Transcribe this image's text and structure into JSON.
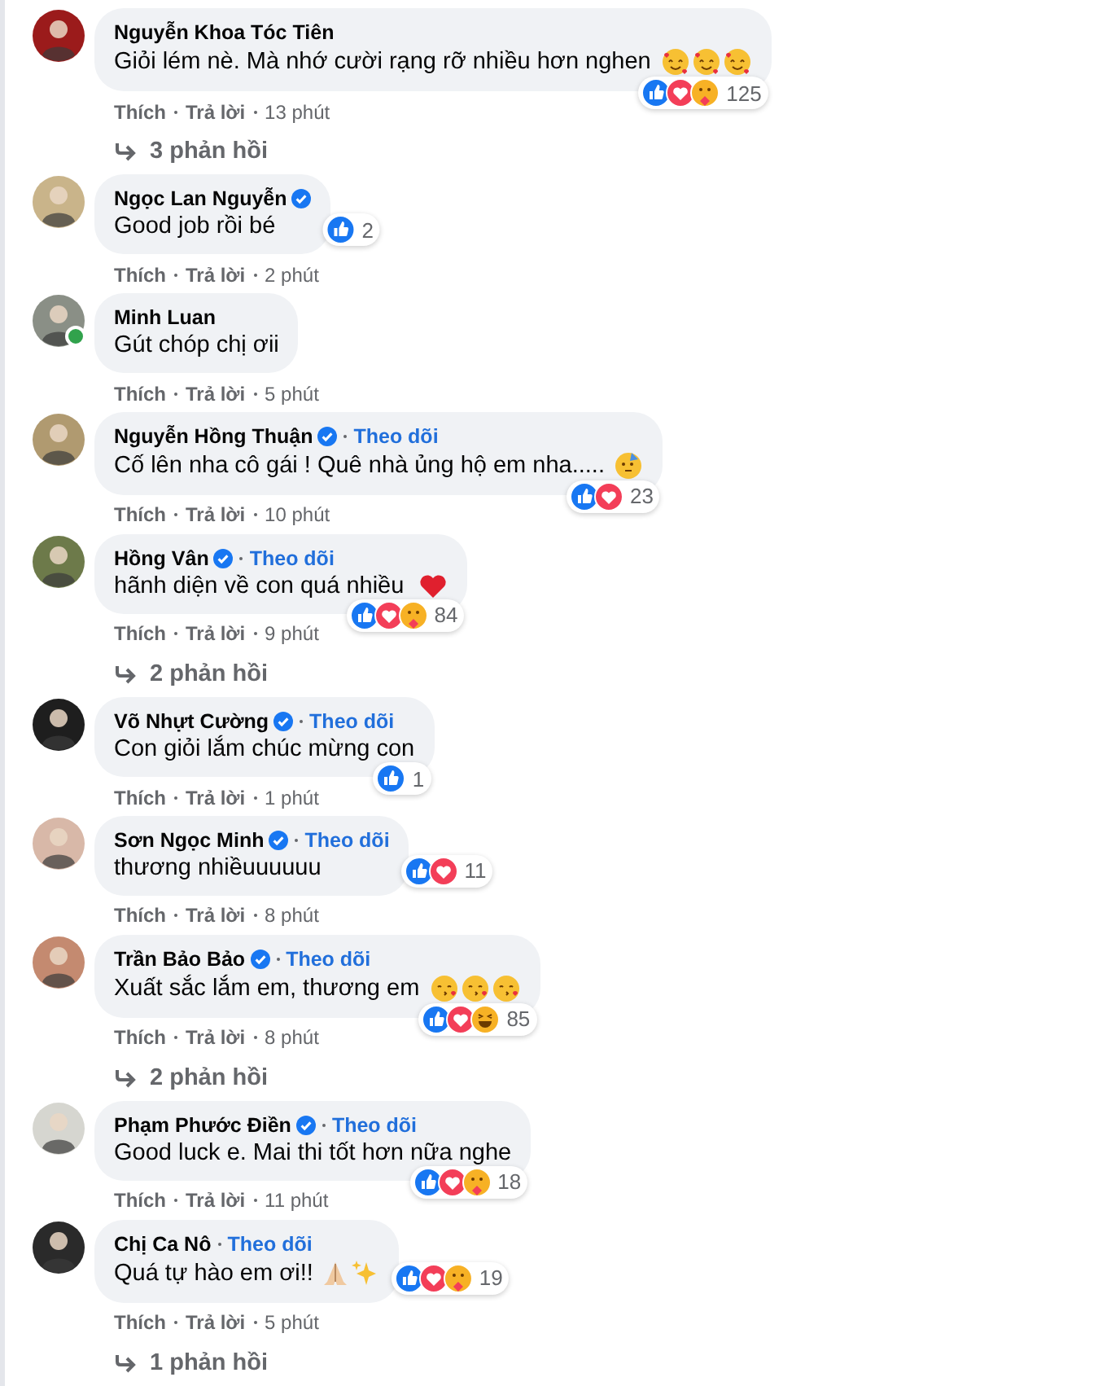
{
  "comments": [
    {
      "name": "Nguyễn Khoa Tóc Tiên",
      "verified": false,
      "online": false,
      "text": "Giỏi lém nè. Mà nhớ cười rạng rỡ nhiều hơn nghen",
      "emojis": [
        {
          "kind": "hearts-face"
        },
        {
          "kind": "hearts-face"
        },
        {
          "kind": "hearts-face"
        }
      ],
      "reactions": [
        {
          "kind": "like"
        },
        {
          "kind": "love"
        },
        {
          "kind": "care"
        }
      ],
      "reaction_count": "125",
      "like": "Thích",
      "reply": "Trả lời",
      "time": "13 phút",
      "replies": "3 phản hồi"
    },
    {
      "name": "Ngọc Lan Nguyễn",
      "verified": true,
      "online": false,
      "text": "Good job rồi bé",
      "reactions": [
        {
          "kind": "like"
        }
      ],
      "reaction_count": "2",
      "like": "Thích",
      "reply": "Trả lời",
      "time": "2 phút"
    },
    {
      "name": "Minh Luan",
      "verified": false,
      "online": true,
      "text": "Gút chóp chị ơii",
      "like": "Thích",
      "reply": "Trả lời",
      "time": "5 phút"
    },
    {
      "name": "Nguyễn Hồng Thuận",
      "verified": true,
      "online": false,
      "follow": "Theo dõi",
      "text": "Cố lên nha cô gái ! Quê nhà ủng hộ em nha.....",
      "emojis": [
        {
          "kind": "party-face"
        }
      ],
      "reactions": [
        {
          "kind": "like"
        },
        {
          "kind": "love"
        }
      ],
      "reaction_count": "23",
      "like": "Thích",
      "reply": "Trả lời",
      "time": "10 phút"
    },
    {
      "name": "Hồng Vân",
      "verified": true,
      "online": false,
      "follow": "Theo dõi",
      "text": "hãnh diện về con quá nhiều",
      "emojis": [
        {
          "kind": "heart"
        }
      ],
      "reactions": [
        {
          "kind": "like"
        },
        {
          "kind": "love"
        },
        {
          "kind": "care"
        }
      ],
      "reaction_count": "84",
      "like": "Thích",
      "reply": "Trả lời",
      "time": "9 phút",
      "replies": "2 phản hồi"
    },
    {
      "name": "Võ Nhựt Cường",
      "verified": true,
      "online": false,
      "follow": "Theo dõi",
      "text": "Con giỏi lắm chúc mừng con",
      "reactions": [
        {
          "kind": "like"
        }
      ],
      "reaction_count": "1",
      "like": "Thích",
      "reply": "Trả lời",
      "time": "1 phút"
    },
    {
      "name": "Sơn Ngọc Minh",
      "verified": true,
      "online": false,
      "follow": "Theo dõi",
      "text": "thương nhiềuuuuuu",
      "reactions": [
        {
          "kind": "like"
        },
        {
          "kind": "love"
        }
      ],
      "reaction_count": "11",
      "like": "Thích",
      "reply": "Trả lời",
      "time": "8 phút"
    },
    {
      "name": "Trần Bảo Bảo",
      "verified": true,
      "online": false,
      "follow": "Theo dõi",
      "text": "Xuất sắc lắm em, thương em",
      "emojis": [
        {
          "kind": "kiss-face"
        },
        {
          "kind": "kiss-face"
        },
        {
          "kind": "kiss-face"
        }
      ],
      "reactions": [
        {
          "kind": "like"
        },
        {
          "kind": "love"
        },
        {
          "kind": "haha"
        }
      ],
      "reaction_count": "85",
      "like": "Thích",
      "reply": "Trả lời",
      "time": "8 phút",
      "replies": "2 phản hồi"
    },
    {
      "name": "Phạm Phước Điền",
      "verified": true,
      "online": false,
      "follow": "Theo dõi",
      "text": "Good luck e. Mai thi tốt hơn nữa nghe",
      "reactions": [
        {
          "kind": "like"
        },
        {
          "kind": "love"
        },
        {
          "kind": "care"
        }
      ],
      "reaction_count": "18",
      "like": "Thích",
      "reply": "Trả lời",
      "time": "11 phút"
    },
    {
      "name": "Chị Ca Nô",
      "verified": false,
      "online": false,
      "follow": "Theo dõi",
      "text": "Quá tự hào em ơi!!",
      "emojis": [
        {
          "kind": "praying-hands"
        },
        {
          "kind": "sparkles"
        }
      ],
      "reactions": [
        {
          "kind": "like"
        },
        {
          "kind": "love"
        },
        {
          "kind": "care"
        }
      ],
      "reaction_count": "19",
      "like": "Thích",
      "reply": "Trả lời",
      "time": "5 phút",
      "replies": "1 phản hồi"
    }
  ]
}
